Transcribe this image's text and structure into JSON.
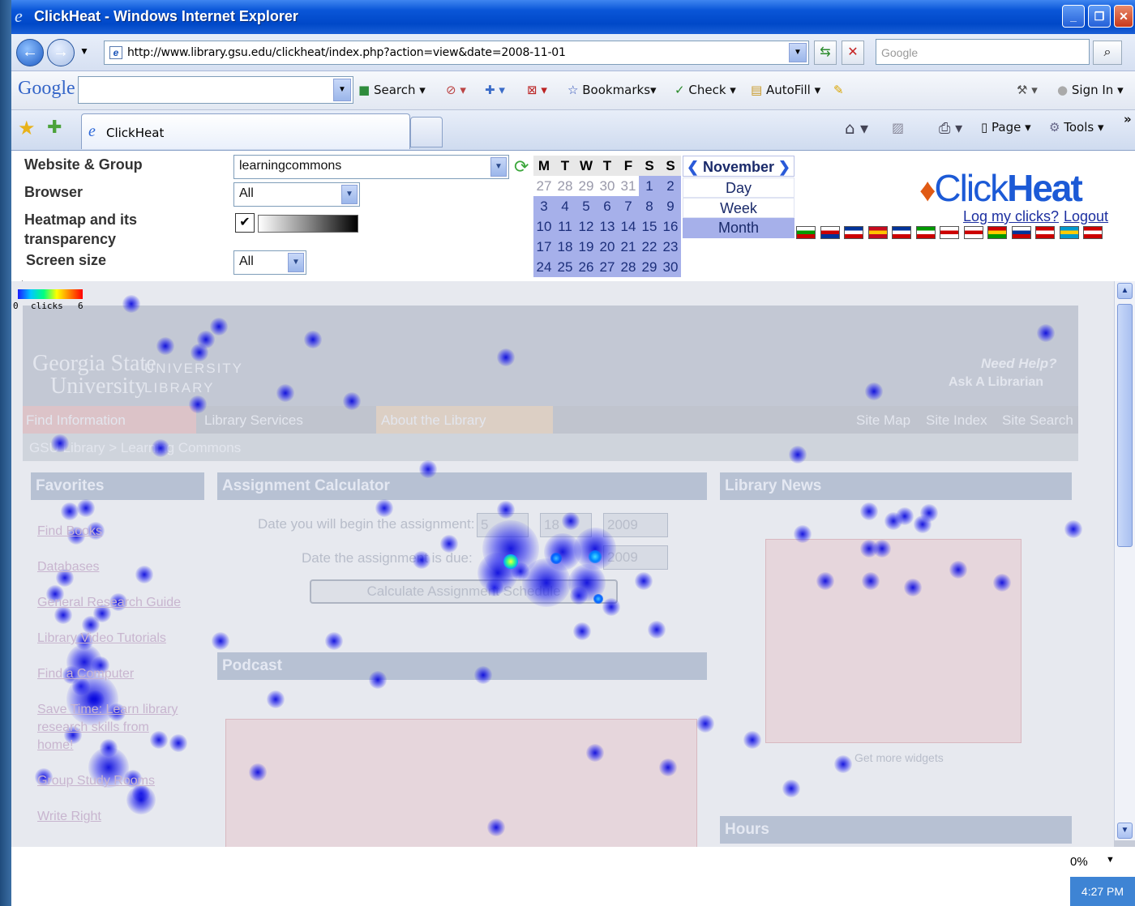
{
  "window": {
    "title": "ClickHeat - Windows Internet Explorer"
  },
  "address": {
    "url": "http://www.library.gsu.edu/clickheat/index.php?action=view&date=2008-11-01",
    "search_placeholder": "Google"
  },
  "google_toolbar": {
    "logo": "Google",
    "search": "Search",
    "bookmarks": "Bookmarks",
    "check": "Check",
    "autofill": "AutoFill",
    "signin": "Sign In"
  },
  "tabs": {
    "current": "ClickHeat",
    "page": "Page",
    "tools": "Tools"
  },
  "controls": {
    "website_label": "Website & Group",
    "website_value": "learningcommons",
    "browser_label": "Browser",
    "browser_value": "All",
    "heatmap_label_1": "Heatmap and its",
    "heatmap_label_2": "transparency",
    "screen_label": "Screen size",
    "screen_value": "All"
  },
  "calendar": {
    "weekdays": [
      "M",
      "T",
      "W",
      "T",
      "F",
      "S",
      "S"
    ],
    "month": "November",
    "periods": [
      "Day",
      "Week",
      "Month"
    ],
    "rows": [
      [
        "27",
        "28",
        "29",
        "30",
        "31",
        "1",
        "2"
      ],
      [
        "3",
        "4",
        "5",
        "6",
        "7",
        "8",
        "9"
      ],
      [
        "10",
        "11",
        "12",
        "13",
        "14",
        "15",
        "16"
      ],
      [
        "17",
        "18",
        "19",
        "20",
        "21",
        "22",
        "23"
      ],
      [
        "24",
        "25",
        "26",
        "27",
        "28",
        "29",
        "30"
      ]
    ]
  },
  "clickheat": {
    "logo_a": "Click",
    "logo_b": "Heat",
    "log_link": "Log my clicks?",
    "logout": "Logout"
  },
  "legend": {
    "label": "clicks",
    "min": "0",
    "max": "6"
  },
  "site": {
    "univ": "Georgia State",
    "univ2": "University",
    "library": "UNIVERSITY",
    "library2": "LIBRARY",
    "help": "Need Help?",
    "help2": "Ask A Librarian",
    "nav": [
      "Find Information",
      "Library Services",
      "About the Library"
    ],
    "toplinks": [
      "Site Map",
      "Site Index",
      "Site Search"
    ],
    "breadcrumb": "GSU Library > Learning Commons",
    "favorites": "Favorites",
    "fav_links": [
      "Find Books",
      "Databases",
      "General Research Guide",
      "Library Video Tutorials",
      "Find a Computer",
      "Save Time: Learn library",
      "research skills from",
      "home!",
      "Group Study Rooms",
      "Write Right"
    ],
    "calc_title": "Assignment Calculator",
    "calc_begin": "Date you will begin the assignment:",
    "calc_due": "Date the assignment is due:",
    "calc_m": "5",
    "calc_d": "18",
    "calc_y": "2009",
    "calc_y2": "2009",
    "calc_btn": "Calculate Assignment Schedule",
    "podcast": "Podcast",
    "news": "Library News",
    "widgets": "Get more widgets",
    "hours": "Hours"
  },
  "status": {
    "zoom": "0%",
    "clock": "4:27 PM"
  }
}
